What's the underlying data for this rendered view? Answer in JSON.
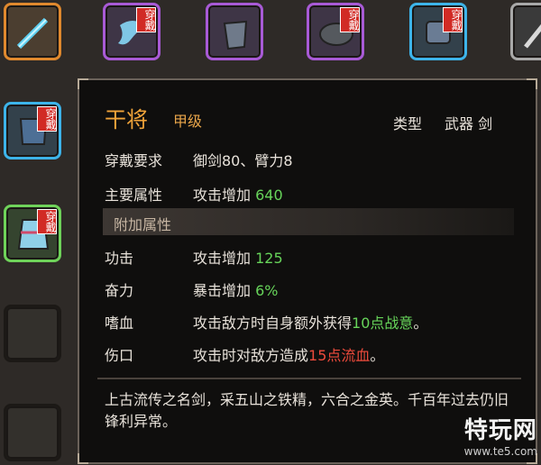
{
  "inventory": {
    "equip_badge": "穿戴",
    "slots": [
      {
        "rarity": "orange",
        "icon": "sword-icon",
        "equipped": false
      },
      {
        "rarity": "purple",
        "icon": "scarf-icon",
        "equipped": true
      },
      {
        "rarity": "purple",
        "icon": "pouch-icon",
        "equipped": false
      },
      {
        "rarity": "purple",
        "icon": "hat-icon",
        "equipped": true
      },
      {
        "rarity": "blue",
        "icon": "glove-icon",
        "equipped": true
      },
      {
        "rarity": "grey",
        "icon": "blade-icon",
        "equipped": false
      },
      {
        "rarity": "blue",
        "icon": "armor-icon",
        "equipped": true
      },
      {
        "rarity": "green",
        "icon": "robe-icon",
        "equipped": true
      }
    ]
  },
  "tooltip": {
    "name": "干将",
    "grade": "甲级",
    "type_label": "类型",
    "type_value": "武器 剑",
    "requirement_label": "穿戴要求",
    "requirement_value": "御剑80、臂力8",
    "main_attr_label": "主要属性",
    "main_attr_prefix": "攻击增加",
    "main_attr_value": "640",
    "section_title": "附加属性",
    "attrs": [
      {
        "label": "功击",
        "prefix": "攻击增加",
        "value": "125",
        "suffix": "",
        "color": "green"
      },
      {
        "label": "奋力",
        "prefix": "暴击增加",
        "value": "6%",
        "suffix": "",
        "color": "green"
      },
      {
        "label": "嗜血",
        "prefix": "攻击敌方时自身额外获得",
        "value": "10点战意",
        "suffix": "。",
        "color": "green"
      },
      {
        "label": "伤口",
        "prefix": "攻击时对敌方造成",
        "value": "15点流血",
        "suffix": "。",
        "color": "red"
      }
    ],
    "description": "上古流传之名剑，采五山之铁精，六合之金英。千百年过去仍旧锋利异常。"
  },
  "watermark": {
    "main": "特玩网",
    "sub": "www.te5.com"
  }
}
